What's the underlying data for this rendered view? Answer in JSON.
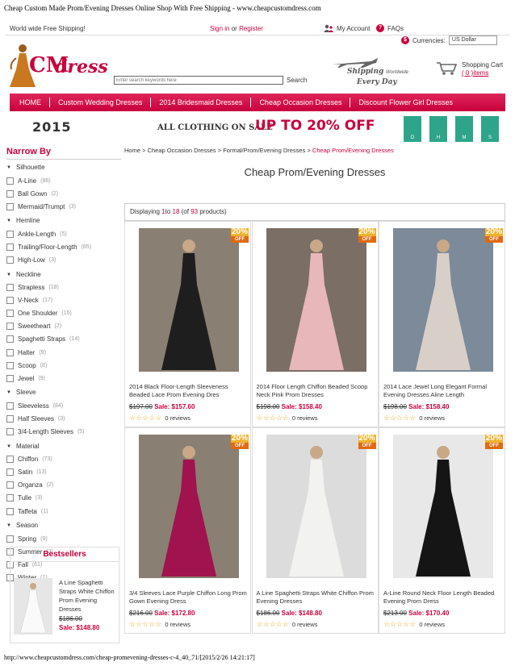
{
  "print_header": "Cheap Custom Made Prom/Evening Dresses Online Shop With Free Shipping - www.cheapcustomdress.com",
  "print_footer": "http://www.cheapcustomdress.com/cheap-promevening-dresses-c-4_40_71/[2015/2/26 14:21:17]",
  "topbar": {
    "shipping": "World wide Free Shipping!",
    "sign_in": "Sign in",
    "or": "or",
    "register": "Register",
    "my_account": "My Account",
    "faqs": "FAQs",
    "faq_icon": "?"
  },
  "currency": {
    "label": "Currencies:",
    "selected": "US Dollar",
    "icon": "$"
  },
  "logo": {
    "cm": "CM",
    "dress": "dress"
  },
  "search": {
    "placeholder": "Enter search keywords here",
    "button": "Search"
  },
  "ship_promo": {
    "line1": "Shipping",
    "worldwide": "Worldwide",
    "line2": "Every Day"
  },
  "cart": {
    "label": "Shopping Cart",
    "items": "( 0 )items"
  },
  "nav": [
    "HOME",
    "Custom Wedding Dresses",
    "2014 Bridesmaid Dresses",
    "Cheap Occasion Dresses",
    "Discount Flower Girl Dresses"
  ],
  "banner": {
    "year": "2015",
    "sale": "ALL CLOTHING ON SALE",
    "upto": "UP TO 20% OFF",
    "countdown": [
      "D",
      "H",
      "M",
      "S"
    ]
  },
  "sidebar": {
    "title": "Narrow By",
    "groups": [
      {
        "name": "Silhouette",
        "items": [
          {
            "label": "A-Line",
            "count": "(86)"
          },
          {
            "label": "Ball Gown",
            "count": "(2)"
          },
          {
            "label": "Mermaid/Trumpt",
            "count": "(3)"
          }
        ]
      },
      {
        "name": "Hemline",
        "items": [
          {
            "label": "Ankle-Length",
            "count": "(5)"
          },
          {
            "label": "Trailing/Floor-Length",
            "count": "(85)"
          },
          {
            "label": "High-Low",
            "count": "(3)"
          }
        ]
      },
      {
        "name": "Neckline",
        "items": [
          {
            "label": "Strapless",
            "count": "(18)"
          },
          {
            "label": "V-Neck",
            "count": "(17)"
          },
          {
            "label": "One Shoulder",
            "count": "(15)"
          },
          {
            "label": "Sweetheart",
            "count": "(2)"
          },
          {
            "label": "Spaghetti Straps",
            "count": "(14)"
          },
          {
            "label": "Halter",
            "count": "(9)"
          },
          {
            "label": "Scoop",
            "count": "(8)"
          },
          {
            "label": "Jewel",
            "count": "(9)"
          }
        ]
      },
      {
        "name": "Sleeve",
        "items": [
          {
            "label": "Sleeveless",
            "count": "(84)"
          },
          {
            "label": "Half Sleeves",
            "count": "(3)"
          },
          {
            "label": "3/4-Length Sleeves",
            "count": "(5)"
          }
        ]
      },
      {
        "name": "Material",
        "items": [
          {
            "label": "Chiffon",
            "count": "(73)"
          },
          {
            "label": "Satin",
            "count": "(13)"
          },
          {
            "label": "Organza",
            "count": "(2)"
          },
          {
            "label": "Tulle",
            "count": "(3)"
          },
          {
            "label": "Taffeta",
            "count": "(1)"
          }
        ]
      },
      {
        "name": "Season",
        "items": [
          {
            "label": "Spring",
            "count": "(9)"
          },
          {
            "label": "Summer",
            "count": "(3)"
          },
          {
            "label": "Fall",
            "count": "(61)"
          },
          {
            "label": "Winter",
            "count": "(1)"
          }
        ]
      }
    ]
  },
  "bestsellers": {
    "title": "Bestsellers",
    "name": "A Line Spaghetti Straps White Chiffon Prom Evening Dresses",
    "old_price": "$186.00",
    "sale_price": "Sale: $148.80"
  },
  "breadcrumb": {
    "items": [
      "Home",
      "Cheap Occasion Dresses",
      "Formal/Prom/Evening Dresses"
    ],
    "sep": ">",
    "current": "Cheap Prom/Evening Dresses"
  },
  "page_title": "Cheap Prom/Evening Dresses",
  "displaying": {
    "prefix": "Displaying",
    "from": "1",
    "to_word": "to",
    "to": "18",
    "of_word": "(of",
    "total": "93",
    "suffix": "products)"
  },
  "off_badge": {
    "pct": "20%",
    "word": "OFF"
  },
  "products": [
    {
      "name": "2014 Black Floor-Length Sleeveness Beaded Lace Prom Evening Dres",
      "old": "$197.00",
      "sale": "Sale: $157.60",
      "reviews": "0 reviews",
      "stars": "☆☆☆☆☆",
      "dress": "#1e1e1e",
      "bg": "#8a7f73"
    },
    {
      "name": "2014 Floor Length Chiffon Beaded Scoop Neck Pink Prom Dresses",
      "old": "$198.00",
      "sale": "Sale: $158.40",
      "reviews": "0 reviews",
      "stars": "☆☆☆☆☆",
      "dress": "#e8b7b9",
      "bg": "#7a6e65"
    },
    {
      "name": "2014 Lace Jewel Long Elegant Formal Evening Dresses Aline Length",
      "old": "$198.00",
      "sale": "Sale: $158.40",
      "reviews": "0 reviews",
      "stars": "☆☆☆☆☆",
      "dress": "#d9cfc9",
      "bg": "#7c8a9a"
    },
    {
      "name": "3/4 Sleeves Lace Purple Chiffon Long Prom Gown Evening Dress",
      "old": "$216.00",
      "sale": "Sale: $172.80",
      "reviews": "0 reviews",
      "stars": "☆☆☆☆☆",
      "dress": "#a0134f",
      "bg": "#8a7f73"
    },
    {
      "name": "A Line Spaghetti Straps White Chiffon Prom Evening Dresses",
      "old": "$186.00",
      "sale": "Sale: $148.80",
      "reviews": "0 reviews",
      "stars": "☆☆☆☆☆",
      "dress": "#f2f2f0",
      "bg": "#dcdcdc"
    },
    {
      "name": "A-Line Round Neck Floor Length Beaded Evening Prom Dress",
      "old": "$213.00",
      "sale": "Sale: $170.40",
      "reviews": "0 reviews",
      "stars": "☆☆☆☆☆",
      "dress": "#151515",
      "bg": "#e8e8e8"
    }
  ]
}
